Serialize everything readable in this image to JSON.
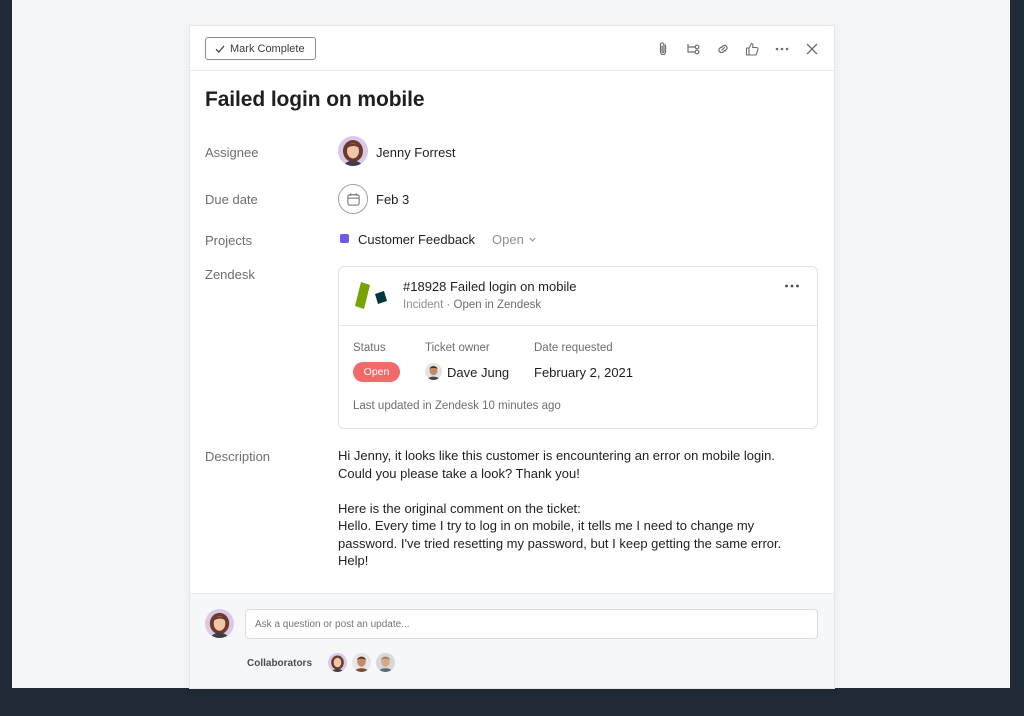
{
  "toolbar": {
    "mark_complete_label": "Mark Complete",
    "icons": [
      "paperclip-icon",
      "subtask-icon",
      "link-icon",
      "thumbs-up-icon",
      "more-icon",
      "close-icon"
    ]
  },
  "task": {
    "title": "Failed login on mobile",
    "fields": {
      "assignee_label": "Assignee",
      "assignee_name": "Jenny Forrest",
      "due_label": "Due date",
      "due_value": "Feb 3",
      "projects_label": "Projects",
      "project_name": "Customer Feedback",
      "project_status": "Open",
      "project_color": "#6b5ce7",
      "zendesk_label": "Zendesk",
      "description_label": "Description"
    }
  },
  "zendesk": {
    "ticket_title": "#18928 Failed login on mobile",
    "ticket_type": "Incident",
    "separator": "·",
    "open_link": "Open in Zendesk",
    "status_label": "Status",
    "status_value": "Open",
    "status_color": "#f06a6a",
    "owner_label": "Ticket owner",
    "owner_name": "Dave Jung",
    "date_label": "Date requested",
    "date_value": "February 2, 2021",
    "updated_text": "Last updated in Zendesk 10 minutes ago"
  },
  "description": {
    "line1": "Hi Jenny, it looks like this customer is encountering an error on mobile login.",
    "line2": "Could you please take a look? Thank you!",
    "line3": "Here is the original comment on the ticket:",
    "line4": "Hello. Every time I try to log in on mobile, it tells me I need to change my",
    "line5": "password. I've tried resetting my password, but I keep getting the same error.",
    "line6": "Help!"
  },
  "footer": {
    "comment_placeholder": "Ask a question or post an update...",
    "collaborators_label": "Collaborators"
  }
}
